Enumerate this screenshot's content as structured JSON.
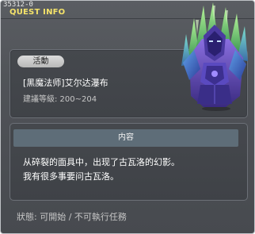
{
  "header": {
    "quest_id": "35312-0",
    "title": "QUEST INFO"
  },
  "quest": {
    "category": "活動",
    "name": "[黑魔法师]艾尔达瀑布",
    "recommend_level": "建議等級: 200~204",
    "npc_icon": "crystal-golem-npc-icon"
  },
  "content": {
    "header": "内容",
    "lines": [
      "从碎裂的面具中，出现了古瓦洛的幻影。",
      "我有很多事要问古瓦洛。"
    ]
  },
  "status": {
    "text": "狀態:  可開始 / 不可執行任務"
  },
  "colors": {
    "title_yellow": "#f5e36a",
    "panel_bg": "#45484d",
    "content_header_bg": "#5e6d78",
    "crystal_green": "#7fd66a",
    "crystal_purple": "#6a4fb8"
  }
}
